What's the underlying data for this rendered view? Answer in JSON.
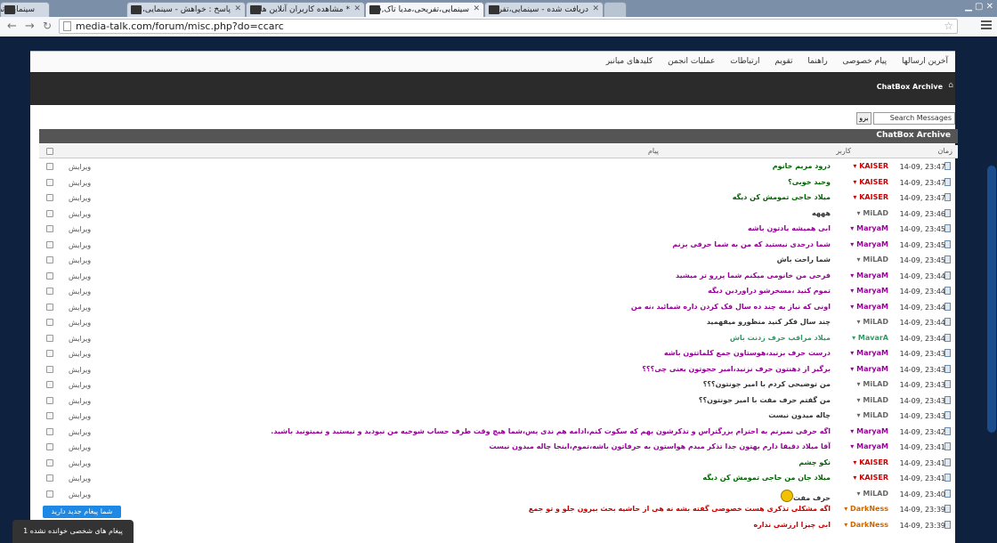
{
  "browser": {
    "tabs": [
      {
        "label": "سینمایی،تفریحی،مدیا تاک,ف"
      },
      {
        "label": "پاسخ : خواهش - سینمایی،تفر"
      },
      {
        "label": "* مشاهده کاربران آنلاین ها،"
      },
      {
        "label": "سینمایی،تفریحی،مدیا تاک,ف"
      },
      {
        "label": "دریافت شده - سینمایی،تفریح"
      }
    ],
    "url": "media-talk.com/forum/misc.php?do=ccarc"
  },
  "navbar": {
    "links": [
      "آخرین ارسالها",
      "پیام خصوصی",
      "راهنما",
      "تقویم",
      "ارتباطات",
      "عملیات انجمن",
      "کلیدهای میانبر"
    ]
  },
  "breadcrumb": "ChatBox Archive",
  "search": {
    "placeholder": "Search Messages",
    "go_label": "برو"
  },
  "archive": {
    "title": "ChatBox Archive"
  },
  "columns": {
    "date": "زمان",
    "user": "کاربر",
    "message": "پیام"
  },
  "edit_label": "ویرایش",
  "colors": {
    "KAISER": "#cc0000",
    "MaryaM": "#990099",
    "MiLAD": "#666666",
    "MavarA": "#339966",
    "DarkNess": "#cc6600"
  },
  "messages": [
    {
      "date": "14-09, 23:47",
      "user": "KAISER",
      "text": "درود مریم خانوم",
      "color": "#006600"
    },
    {
      "date": "14-09, 23:47",
      "user": "KAISER",
      "text": "وحید خوبی؟",
      "color": "#006600"
    },
    {
      "date": "14-09, 23:47",
      "user": "KAISER",
      "text": "میلاد حاجی تمومش کن دیگه",
      "color": "#006600"
    },
    {
      "date": "14-09, 23:46",
      "user": "MiLAD",
      "text": "هههه",
      "color": "#333333"
    },
    {
      "date": "14-09, 23:45",
      "user": "MaryaM",
      "text": "ابی همیشه یادتون باشه",
      "color": "#990099"
    },
    {
      "date": "14-09, 23:45",
      "user": "MaryaM",
      "text": "شما درحدی نیستید که من به شما حرفی بزنم",
      "color": "#990099"
    },
    {
      "date": "14-09, 23:45",
      "user": "MiLAD",
      "text": "شما راحت باش",
      "color": "#333333"
    },
    {
      "date": "14-09, 23:44",
      "user": "MaryaM",
      "text": "فرحی من خانومی میکنم شما پررو تر میشید",
      "color": "#990099"
    },
    {
      "date": "14-09, 23:44",
      "user": "MaryaM",
      "text": "تموم کنید ،مسخرشو دراوردین دیگه",
      "color": "#990099"
    },
    {
      "date": "14-09, 23:44",
      "user": "MaryaM",
      "text": "اونی که نیاز به چند ده سال فک کردن داره شمائید ،نه من",
      "color": "#990099"
    },
    {
      "date": "14-09, 23:44",
      "user": "MiLAD",
      "text": "چند سال فکر کنید منظورو میفهمید",
      "color": "#333333"
    },
    {
      "date": "14-09, 23:44",
      "user": "MavarA",
      "text": "میلاد مراقب حرف زدنت باش",
      "color": "#339966"
    },
    {
      "date": "14-09, 23:43",
      "user": "MaryaM",
      "text": "درست حرف بزنید،هوستاون جمع کلماتتون باشه",
      "color": "#990099"
    },
    {
      "date": "14-09, 23:43",
      "user": "MaryaM",
      "text": "برگیر از دهنتون حرف نزنید،امیر حجوتون یعنی چی؟؟؟",
      "color": "#990099"
    },
    {
      "date": "14-09, 23:43",
      "user": "MiLAD",
      "text": "من توضیحی کردم با امیر جونتون؟؟؟",
      "color": "#333333"
    },
    {
      "date": "14-09, 23:43",
      "user": "MiLAD",
      "text": "من گفتم حرف مفت با امیر جونتون؟؟",
      "color": "#333333"
    },
    {
      "date": "14-09, 23:43",
      "user": "MiLAD",
      "text": "چاله میدون نیست",
      "color": "#333333"
    },
    {
      "date": "14-09, 23:42",
      "user": "MaryaM",
      "text": "اگه حرفی نمیزنم به احترام بزرگتراس و تذکرشون بهم که سکوت کنم،ادامه هم ندی پس،شما هیچ وقت طرف حساب شوخیه من نبودید و نیستید و نمیتونید باشید.",
      "color": "#990099"
    },
    {
      "date": "14-09, 23:41",
      "user": "MaryaM",
      "text": "آقا میلاد دقیقا دارم بهتون جدا تذکر میدم هواستون به حرفاتون باشه،تموم،اینجا چاله میدون نیست",
      "color": "#990099"
    },
    {
      "date": "14-09, 23:41",
      "user": "KAISER",
      "text": "نکو چشم",
      "color": "#006600"
    },
    {
      "date": "14-09, 23:41",
      "user": "KAISER",
      "text": "میلاد جان من حاجی تمومش کن دیگه",
      "color": "#006600"
    },
    {
      "date": "14-09, 23:40",
      "user": "MiLAD",
      "text": "حرف مفت",
      "color": "#333333",
      "emoji": true
    },
    {
      "date": "14-09, 23:39",
      "user": "DarkNess",
      "text": "اگه مشکلی تذکری هست خصوصی گفته بشه نه هی از حاشیه بحث بیرون جلو و تو جمع",
      "color": "#cc0000"
    },
    {
      "date": "14-09, 23:39",
      "user": "DarkNess",
      "text": "ابی چیزا ارزشی نداره",
      "color": "#cc0000"
    }
  ],
  "notifications": {
    "new_message": "شما پیغام جدید دارید",
    "unread_pm": "1 پیغام های شخصی خوانده نشده"
  }
}
